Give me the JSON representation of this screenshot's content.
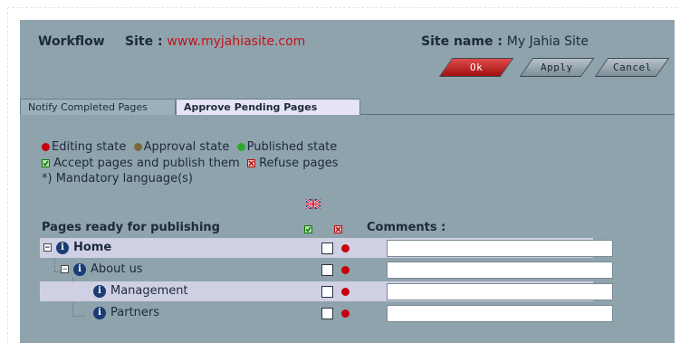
{
  "header": {
    "workflow_label": "Workflow",
    "site_label": "Site :",
    "site_value": "www.myjahiasite.com",
    "site_name_label": "Site name :",
    "site_name_value": "My Jahia Site"
  },
  "buttons": {
    "ok": "Ok",
    "apply": "Apply",
    "cancel": "Cancel"
  },
  "tabs": [
    {
      "label": "Notify Completed Pages",
      "active": false
    },
    {
      "label": "Approve Pending Pages",
      "active": true
    }
  ],
  "legend": {
    "editing": "Editing state",
    "approval": "Approval state",
    "published": "Published state",
    "accept": "Accept pages and publish them",
    "refuse": "Refuse pages",
    "mandatory": "*) Mandatory language(s)"
  },
  "table": {
    "pages_header": "Pages ready for publishing",
    "comments_header": "Comments :",
    "rows": [
      {
        "label": "Home",
        "bold": true,
        "comment": ""
      },
      {
        "label": "About us",
        "bold": false,
        "comment": ""
      },
      {
        "label": "Management",
        "bold": false,
        "comment": ""
      },
      {
        "label": "Partners",
        "bold": false,
        "comment": ""
      }
    ]
  },
  "colors": {
    "editing": "#c8000a",
    "approval": "#7a6a3a",
    "published": "#2fa82f",
    "panel": "#8fa3ad",
    "highlight": "#d0d0e4"
  }
}
